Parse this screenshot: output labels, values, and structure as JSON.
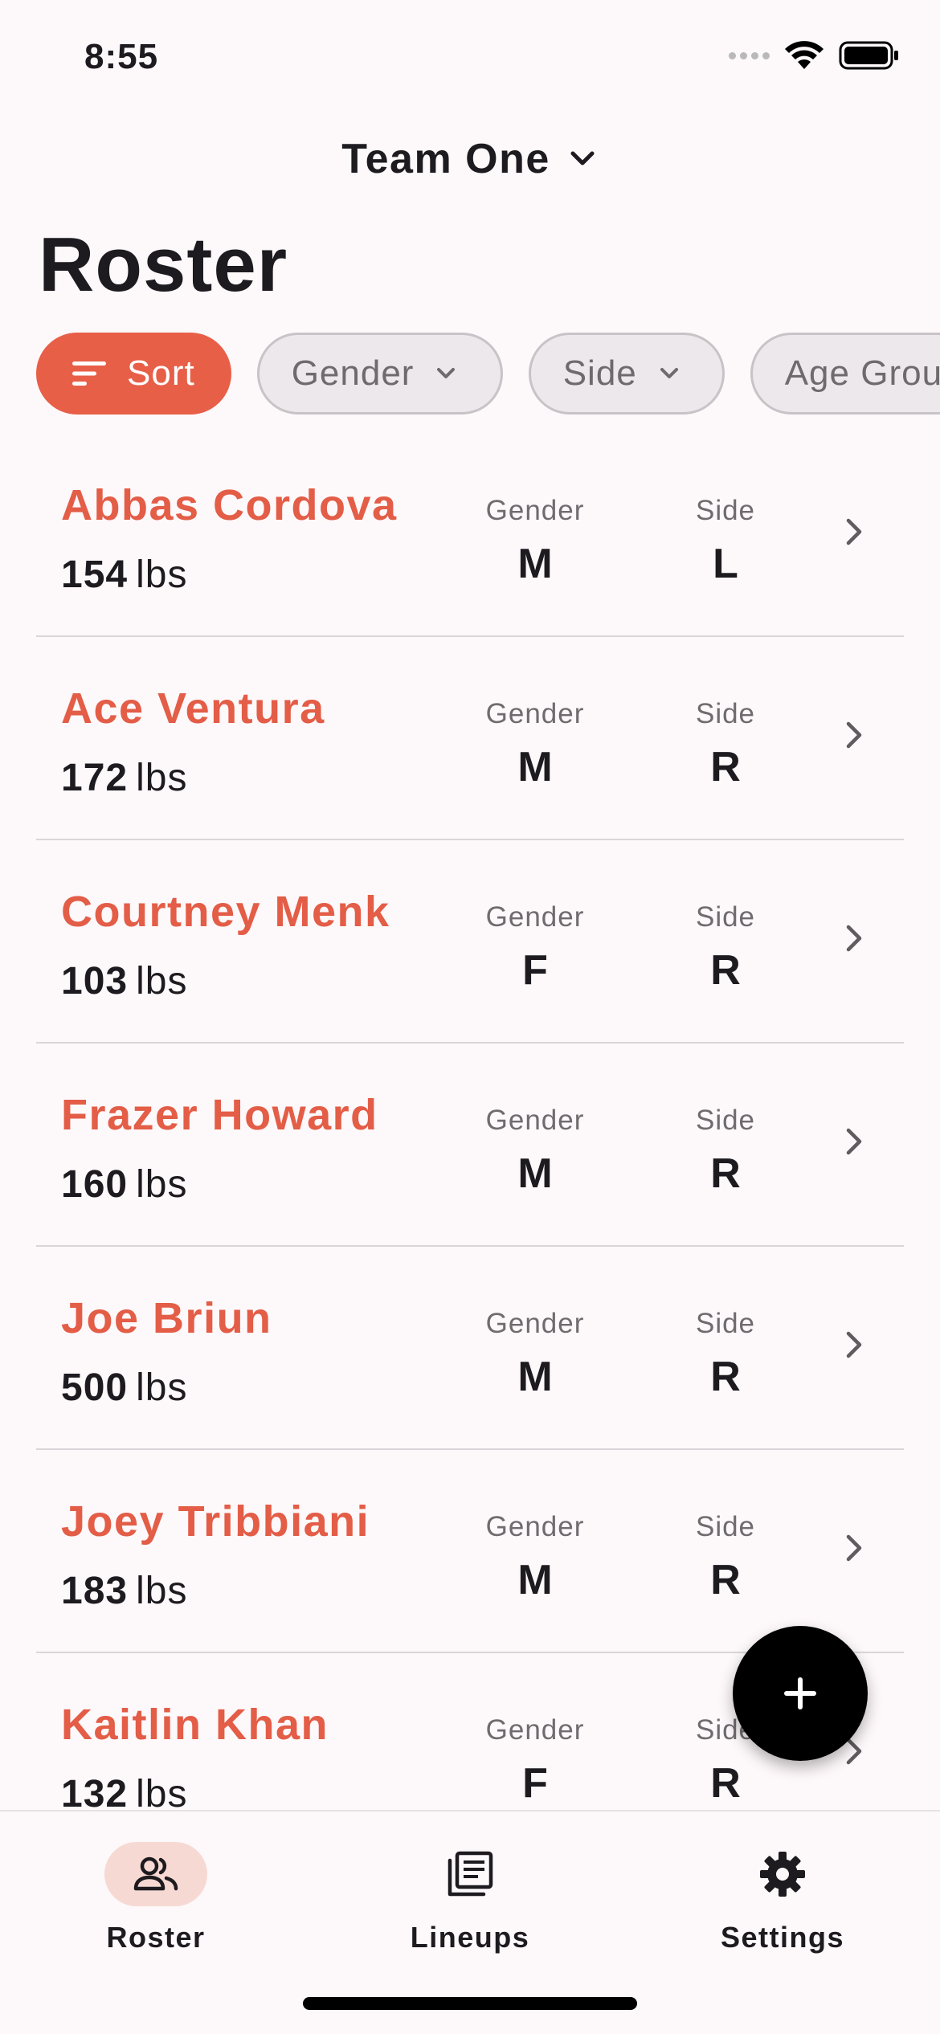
{
  "status_bar": {
    "time": "8:55"
  },
  "header": {
    "team_name": "Team One",
    "title": "Roster"
  },
  "filters": {
    "sort_label": "Sort",
    "gender_label": "Gender",
    "side_label": "Side",
    "age_group_label": "Age Group"
  },
  "columns": {
    "gender": "Gender",
    "side": "Side"
  },
  "roster": [
    {
      "name": "Abbas Cordova",
      "weight": "154",
      "unit": "lbs",
      "gender": "M",
      "side": "L"
    },
    {
      "name": "Ace Ventura",
      "weight": "172",
      "unit": "lbs",
      "gender": "M",
      "side": "R"
    },
    {
      "name": "Courtney Menk",
      "weight": "103",
      "unit": "lbs",
      "gender": "F",
      "side": "R"
    },
    {
      "name": "Frazer Howard",
      "weight": "160",
      "unit": "lbs",
      "gender": "M",
      "side": "R"
    },
    {
      "name": "Joe Briun",
      "weight": "500",
      "unit": "lbs",
      "gender": "M",
      "side": "R"
    },
    {
      "name": "Joey Tribbiani",
      "weight": "183",
      "unit": "lbs",
      "gender": "M",
      "side": "R"
    },
    {
      "name": "Kaitlin Khan",
      "weight": "132",
      "unit": "lbs",
      "gender": "F",
      "side": "R"
    }
  ],
  "nav": {
    "roster": "Roster",
    "lineups": "Lineups",
    "settings": "Settings"
  },
  "colors": {
    "accent": "#e85f48",
    "name_text": "#e35d47",
    "background": "#fdf8fa",
    "fab": "#000000"
  },
  "icons": {
    "sort": "sort-lines-icon",
    "dropdown": "chevron-down-icon",
    "row": "chevron-right-icon",
    "fab": "plus-icon",
    "roster": "people-icon",
    "lineups": "document-list-icon",
    "settings": "gear-icon"
  }
}
